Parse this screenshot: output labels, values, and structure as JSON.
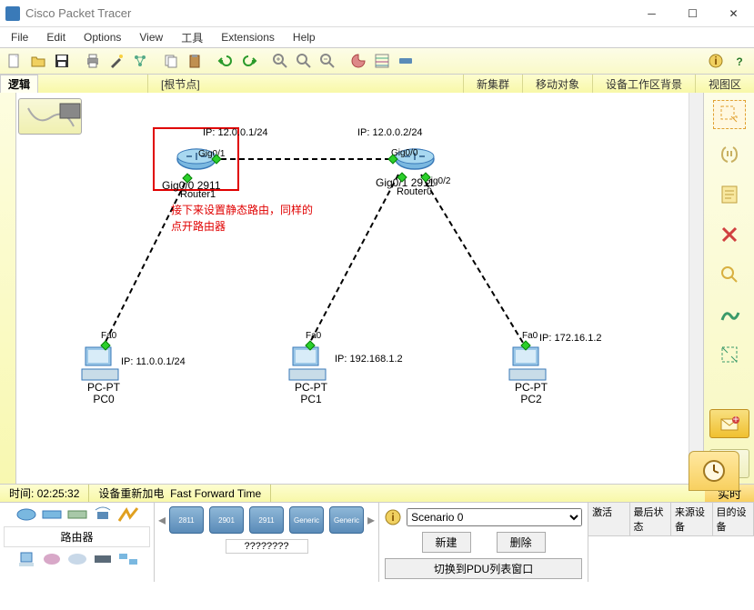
{
  "title": "Cisco Packet Tracer",
  "menubar": [
    "File",
    "Edit",
    "Options",
    "View",
    "工具",
    "Extensions",
    "Help"
  ],
  "yellowbar": {
    "logic": "逻辑",
    "root": "[根节点]",
    "new_cluster": "新集群",
    "move_obj": "移动对象",
    "workspace_bg": "设备工作区背景",
    "viewport": "视图区"
  },
  "annotation": {
    "line1": "接下来设置静态路由，同样的",
    "line2": "点开路由器"
  },
  "topology": {
    "router1": {
      "name": "Router1",
      "ports": {
        "g01": "Gig0/1",
        "g0_0_2911": "Gig0/0 2911"
      },
      "ip": "IP: 12.0.0.1/24"
    },
    "router0": {
      "name": "Router0",
      "ports": {
        "g00": "Gig0/0",
        "g01_2911": "Gig0/1 2911",
        "g02": "Gig0/2"
      },
      "ip": "IP: 12.0.0.2/24"
    },
    "pc0": {
      "type": "PC-PT",
      "name": "PC0",
      "port": "Fa0",
      "ip": "IP: 11.0.0.1/24"
    },
    "pc1": {
      "type": "PC-PT",
      "name": "PC1",
      "port": "Fa0",
      "ip": "IP: 192.168.1.2"
    },
    "pc2": {
      "type": "PC-PT",
      "name": "PC2",
      "port": "Fa0",
      "ip": "IP: 172.16.1.2"
    }
  },
  "statusbar": {
    "time_label": "时间:",
    "time_value": "02:25:32",
    "power": "设备重新加电",
    "fft": "Fast Forward Time",
    "realtime": "实时"
  },
  "tray": {
    "category_label": "路由器",
    "devices": [
      "2811",
      "2901",
      "2911",
      "Generic",
      "Generic"
    ],
    "placeholder": "????????",
    "scenario": {
      "selected": "Scenario 0",
      "new": "新建",
      "delete": "删除",
      "toggle": "切换到PDU列表窗口"
    },
    "pdu_headers": [
      "激活",
      "最后状态",
      "来源设备",
      "目的设备"
    ]
  }
}
